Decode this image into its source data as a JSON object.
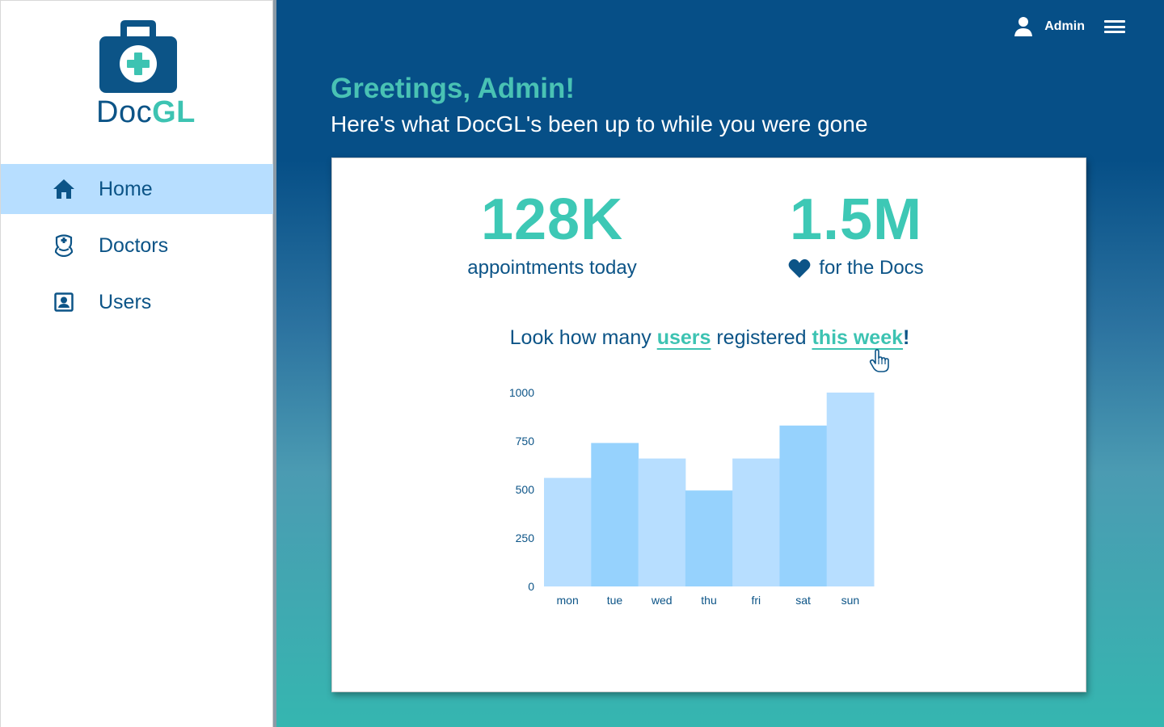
{
  "brand": {
    "name_part1": "Doc",
    "name_part2": "GL"
  },
  "sidebar": {
    "items": [
      {
        "label": "Home",
        "icon": "home-icon",
        "active": true
      },
      {
        "label": "Doctors",
        "icon": "doctor-icon",
        "active": false
      },
      {
        "label": "Users",
        "icon": "user-card-icon",
        "active": false
      }
    ]
  },
  "topbar": {
    "user": "Admin",
    "user_icon": "user-icon",
    "menu_icon": "hamburger-menu-icon"
  },
  "main": {
    "greeting": "Greetings, Admin!",
    "subgreeting": "Here's what DocGL's been up to while you were gone"
  },
  "stats": [
    {
      "value": "128K",
      "label": "appointments today"
    },
    {
      "value": "1.5M",
      "label": "for the Docs",
      "icon": "heart-icon"
    }
  ],
  "chart_heading": {
    "prefix": "Look how many ",
    "link1": "users",
    "middle": " registered ",
    "link2": "this week",
    "suffix": "!"
  },
  "colors": {
    "navy": "#0c5487",
    "teal": "#3dc3b2",
    "active_nav": "#b7deff",
    "bar_light": "#b7deff",
    "bar_dark": "#96d2fd"
  },
  "chart_data": {
    "type": "bar",
    "categories": [
      "mon",
      "tue",
      "wed",
      "thu",
      "fri",
      "sat",
      "sun"
    ],
    "values": [
      560,
      740,
      660,
      495,
      660,
      830,
      1000
    ],
    "yticks": [
      0,
      250,
      500,
      750,
      1000
    ],
    "ylim": [
      0,
      1000
    ],
    "grid": false,
    "legend": "none"
  }
}
